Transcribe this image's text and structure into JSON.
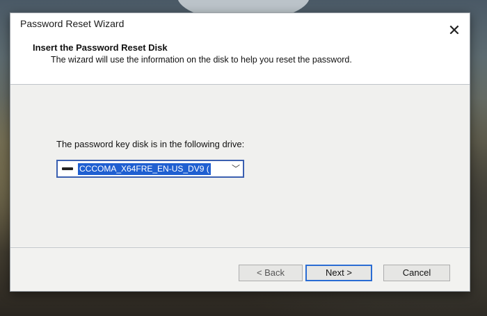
{
  "window": {
    "title": "Password Reset Wizard",
    "close_glyph": "✕"
  },
  "header": {
    "title": "Insert the Password Reset Disk",
    "subtitle": "The wizard will use the information on the disk to help you reset the password."
  },
  "main": {
    "drive_label": "The password key disk is in the following drive:",
    "drive_selected": "CCCOMA_X64FRE_EN-US_DV9 (",
    "drive_icon": "usb-drive-icon",
    "dropdown_glyph": "﹀"
  },
  "footer": {
    "back_label": "< Back",
    "next_label": "Next >",
    "cancel_label": "Cancel"
  },
  "colors": {
    "selection": "#1f5fd1",
    "focus_border": "#2a6cd3"
  }
}
